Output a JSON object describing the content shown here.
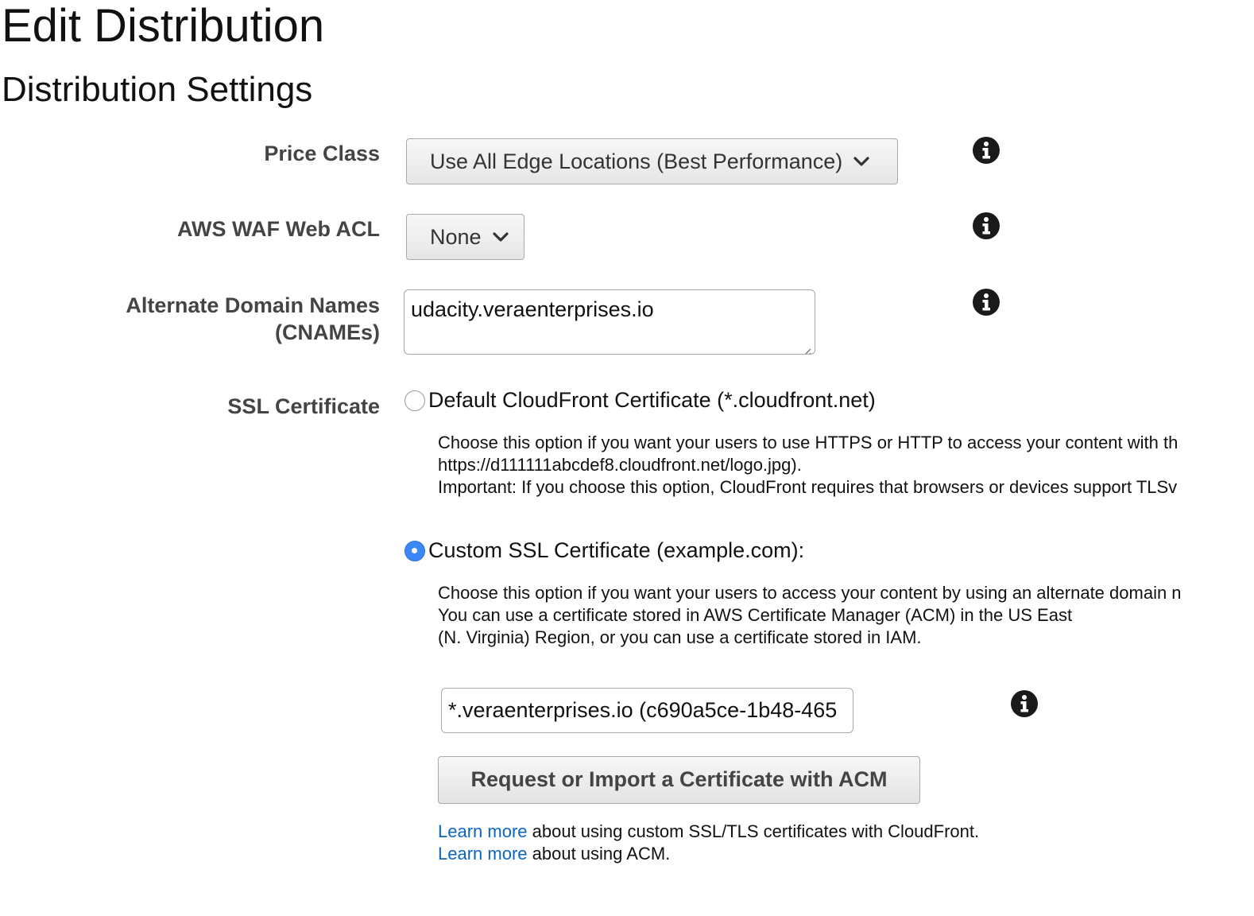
{
  "page": {
    "title": "Edit Distribution",
    "section_title": "Distribution Settings"
  },
  "price_class": {
    "label": "Price Class",
    "selected": "Use All Edge Locations (Best Performance)"
  },
  "waf": {
    "label": "AWS WAF Web ACL",
    "selected": "None"
  },
  "cnames": {
    "label_line1": "Alternate Domain Names",
    "label_line2": "(CNAMEs)",
    "value": "udacity.veraenterprises.io"
  },
  "ssl": {
    "label": "SSL Certificate",
    "default_option": {
      "label": "Default CloudFront Certificate (*.cloudfront.net)",
      "selected": false,
      "desc_line1": "Choose this option if you want your users to use HTTPS or HTTP to access your content with th",
      "desc_line2": "https://d111111abcdef8.cloudfront.net/logo.jpg).",
      "desc_line3": "Important: If you choose this option, CloudFront requires that browsers or devices support TLSv"
    },
    "custom_option": {
      "label": "Custom SSL Certificate (example.com):",
      "selected": true,
      "desc_line1": "Choose this option if you want your users to access your content by using an alternate domain n",
      "desc_line2": "You can use a certificate stored in AWS Certificate Manager (ACM) in the US East",
      "desc_line3": "(N. Virginia) Region, or you can use a certificate stored in IAM."
    },
    "certificate_value": "*.veraenterprises.io (c690a5ce-1b48-465",
    "acm_button": "Request or Import a Certificate with ACM",
    "learn_more_1_link": "Learn more",
    "learn_more_1_text": " about using custom SSL/TLS certificates with CloudFront.",
    "learn_more_2_link": "Learn more",
    "learn_more_2_text": " about using ACM."
  },
  "icons": {
    "info": "info-icon",
    "dropdown": "chevron-down-icon"
  },
  "colors": {
    "link": "#0b66c3",
    "radio_selected": "#3b87f5",
    "label": "#444444"
  }
}
